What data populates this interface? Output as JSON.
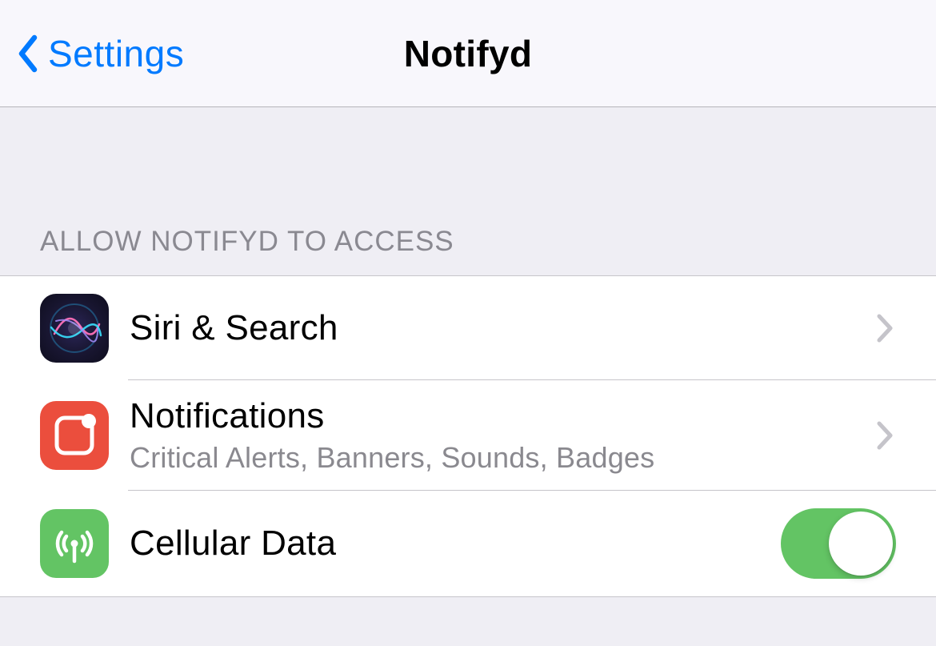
{
  "nav": {
    "back_label": "Settings",
    "title": "Notifyd"
  },
  "section": {
    "header": "ALLOW NOTIFYD TO ACCESS"
  },
  "rows": {
    "siri": {
      "title": "Siri & Search"
    },
    "notifications": {
      "title": "Notifications",
      "subtitle": "Critical Alerts, Banners, Sounds, Badges"
    },
    "cellular": {
      "title": "Cellular Data",
      "toggle_on": true
    }
  },
  "colors": {
    "tint": "#007aff",
    "toggle_on": "#63c464",
    "notifications_icon": "#eb4e3d",
    "cellular_icon": "#63c464"
  }
}
